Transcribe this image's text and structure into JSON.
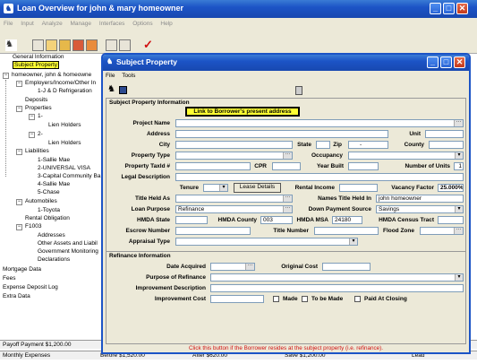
{
  "main_window": {
    "title": "Loan Overview for john & mary homeowner",
    "menu": [
      "File",
      "Input",
      "Analyze",
      "Manage",
      "Interfaces",
      "Options",
      "Help"
    ]
  },
  "tree": {
    "items": [
      "General Information",
      "Subject Property",
      "homeowner, john & homeowne",
      "Employers/Income/Other In",
      "1-J & D Refrigeration",
      "Deposits",
      "Properties",
      "1-",
      "Lien Holders",
      "2-",
      "Lien Holders",
      "Liabilities",
      "1-Sallie Mae",
      "2-UNIVERSAL VISA",
      "3-Capital Community Ba",
      "4-Sallie Mae",
      "5-Chase",
      "Automobiles",
      "1-Toyota",
      "Rental Obligation",
      "F1003",
      "Addresses",
      "Other Assets and Liabil",
      "Government Monitoring",
      "Declarations",
      "Mortgage Data",
      "Fees",
      "Expense Deposit Log",
      "Extra Data"
    ]
  },
  "bottom_rows": [
    {
      "label": "Payoff Payment $1,200.00",
      "cells": [
        "",
        "",
        "",
        ""
      ]
    },
    {
      "label": "Monthly Expenses",
      "cells": [
        "Before $1,520.00",
        "After $620.00",
        "Save $1,200.00",
        "Lead"
      ]
    }
  ],
  "dialog": {
    "title": "Subject Property",
    "menu": [
      "File",
      "Tools"
    ],
    "section_title": "Subject Property Information",
    "link_button": "Link to Borrower's present address",
    "labels": {
      "project_name": "Project Name",
      "address": "Address",
      "unit": "Unit",
      "city": "City",
      "state": "State",
      "zip": "Zip",
      "county": "County",
      "property_type": "Property Type",
      "occupancy": "Occupancy",
      "tax_id": "Property TaxId #",
      "cpr": "CPR",
      "year_built": "Year Built",
      "num_units": "Number of Units",
      "legal_desc": "Legal Description",
      "tenure": "Tenure",
      "lease_details": "Lease Details",
      "rental_income": "Rental Income",
      "vacancy_factor": "Vacancy Factor",
      "title_held_as": "Title Held As",
      "names_title": "Names Title Held In",
      "loan_purpose": "Loan Purpose",
      "down_payment": "Down Payment Source",
      "hmda_state": "HMDA State",
      "hmda_county": "HMDA County",
      "hmda_msa": "HMDA MSA",
      "hmda_tract": "HMDA Census Tract",
      "escrow": "Escrow Number",
      "title_number": "Title Number",
      "flood_zone": "Flood Zone",
      "appraisal_type": "Appraisal Type"
    },
    "values": {
      "zip_dash": "-",
      "num_units": "1",
      "vacancy_factor": "25.000%",
      "names_title": "john homeowner",
      "loan_purpose": "Refinance",
      "down_payment": "Savings",
      "hmda_county": "003",
      "hmda_msa": "24180"
    },
    "refi": {
      "title": "Refinance Information",
      "date_acquired": "Date Acquired",
      "original_cost": "Original Cost",
      "purpose": "Purpose of Refinance",
      "improvement_desc": "Improvement Description",
      "improvement_cost": "Improvement Cost",
      "made": "Made",
      "to_be_made": "To be Made",
      "paid_at_closing": "Paid At Closing"
    },
    "status_text": "Click this button if the Borrower resides at the subject property (i.e. refinance)."
  }
}
